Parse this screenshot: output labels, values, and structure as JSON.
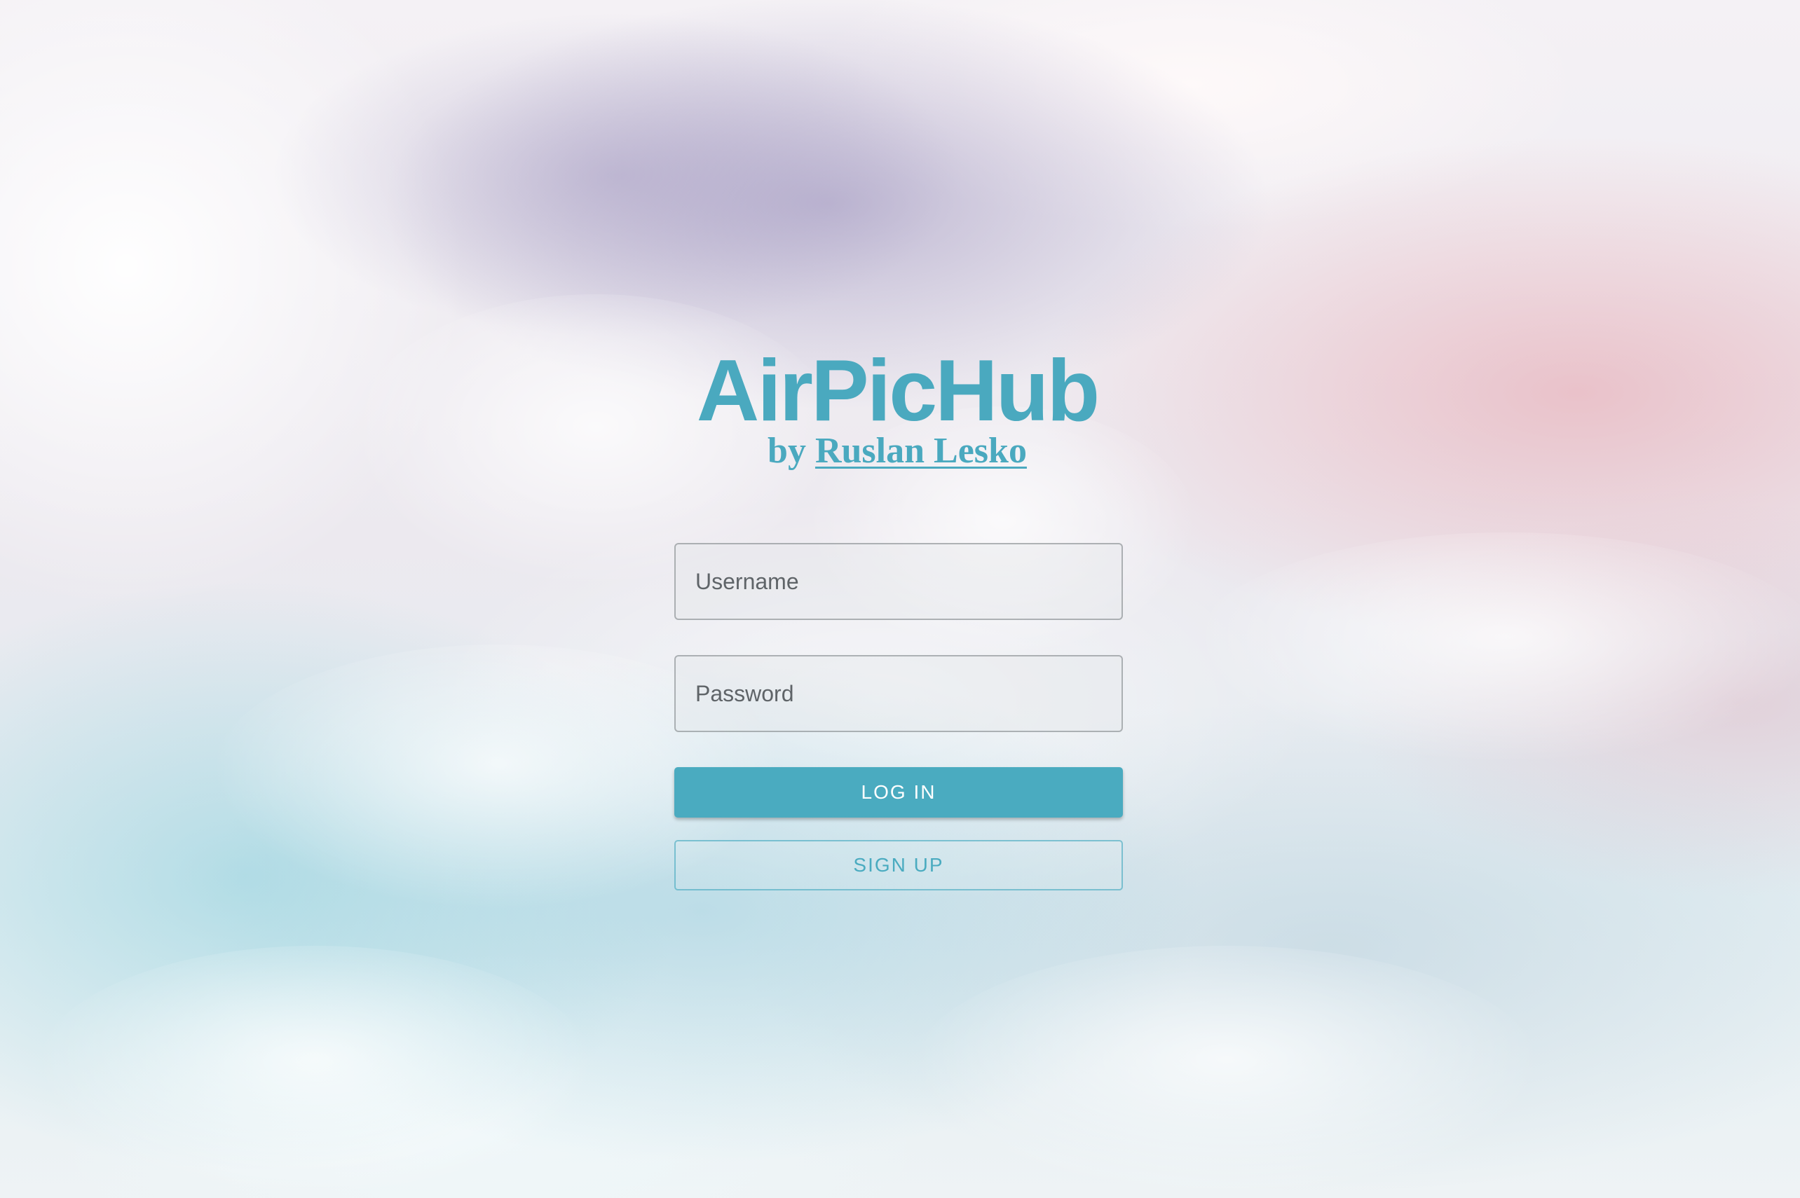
{
  "app": {
    "title": "AirPicHub",
    "byline_prefix": "by",
    "author_link": "Ruslan Lesko"
  },
  "form": {
    "username_placeholder": "Username",
    "password_placeholder": "Password",
    "login_label": "LOG IN",
    "signup_label": "SIGN UP"
  },
  "colors": {
    "accent": "#4aabc0",
    "button_text": "#ffffff"
  }
}
